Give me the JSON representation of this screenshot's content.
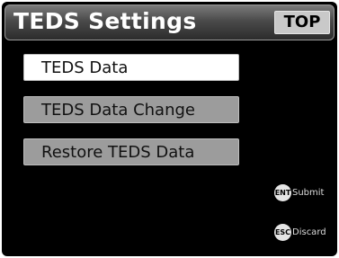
{
  "header": {
    "title": "TEDS Settings",
    "top_label": "TOP"
  },
  "menu": {
    "items": [
      {
        "label": "TEDS Data",
        "selected": true
      },
      {
        "label": "TEDS Data Change",
        "selected": false
      },
      {
        "label": "Restore TEDS Data",
        "selected": false
      }
    ]
  },
  "hints": {
    "submit": {
      "key": "ENT",
      "label": "Submit"
    },
    "discard": {
      "key": "ESC",
      "label": "Discard"
    }
  },
  "colors": {
    "background": "#000000",
    "selected_item": "#ffffff",
    "normal_item": "#9c9c9c",
    "top_button": "#c9c9c9"
  }
}
